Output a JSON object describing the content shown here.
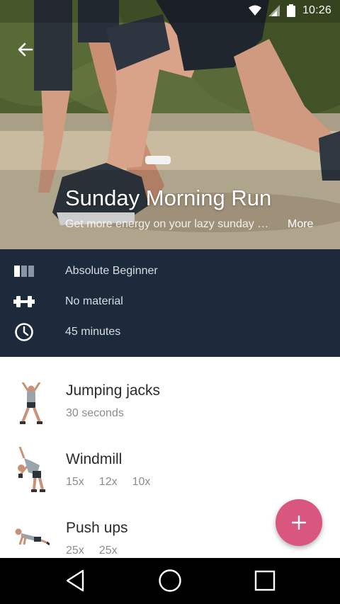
{
  "status_bar": {
    "time": "10:26",
    "icons": [
      "wifi-icon",
      "cell-signal-icon",
      "battery-icon"
    ]
  },
  "hero": {
    "title": "Sunday Morning Run",
    "subtitle": "Get more energy on your lazy sunday morning",
    "more_label": "More"
  },
  "info": {
    "level": {
      "icon": "level-bars-icon",
      "text": "Absolute Beginner"
    },
    "material": {
      "icon": "dumbbell-icon",
      "text": "No material"
    },
    "duration": {
      "icon": "clock-icon",
      "text": "45 minutes"
    }
  },
  "exercises": [
    {
      "name": "Jumping jacks",
      "reps": [
        "30 seconds"
      ]
    },
    {
      "name": "Windmill",
      "reps": [
        "15x",
        "12x",
        "10x"
      ]
    },
    {
      "name": "Push ups",
      "reps": [
        "25x",
        "25x"
      ]
    }
  ],
  "fab": {
    "label": "+"
  },
  "colors": {
    "panel": "#1c2a3c",
    "accent": "#d9567e"
  }
}
